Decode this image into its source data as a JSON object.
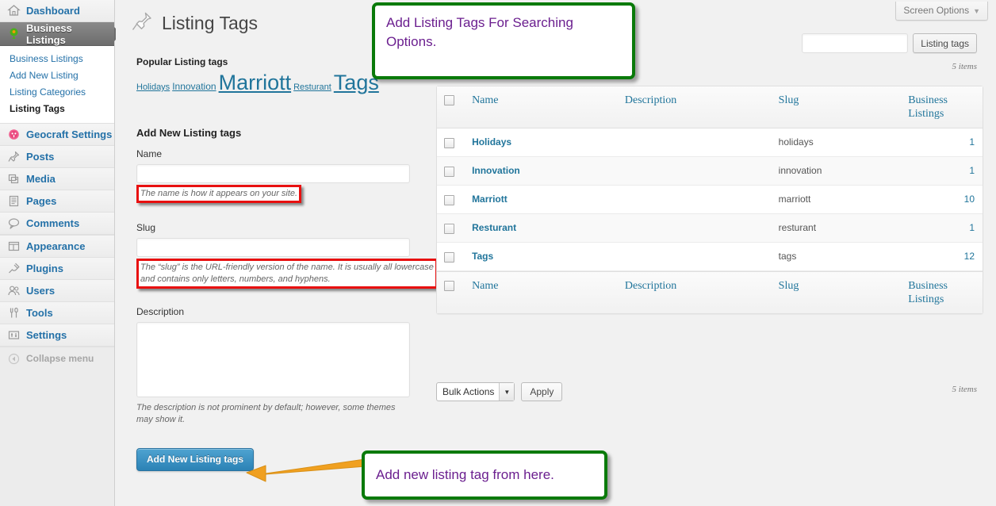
{
  "sidebar": {
    "items": [
      {
        "label": "Dashboard",
        "icon": "dashboard-icon",
        "active": false
      },
      {
        "label": "Business Listings",
        "icon": "business-listings-icon",
        "active": true
      },
      {
        "label": "Geocraft Settings",
        "icon": "geocraft-icon",
        "active": false
      },
      {
        "label": "Posts",
        "icon": "pin-icon",
        "active": false
      },
      {
        "label": "Media",
        "icon": "media-icon",
        "active": false
      },
      {
        "label": "Pages",
        "icon": "pages-icon",
        "active": false
      },
      {
        "label": "Comments",
        "icon": "comments-icon",
        "active": false
      },
      {
        "label": "Appearance",
        "icon": "appearance-icon",
        "active": false
      },
      {
        "label": "Plugins",
        "icon": "plugins-icon",
        "active": false
      },
      {
        "label": "Users",
        "icon": "users-icon",
        "active": false
      },
      {
        "label": "Tools",
        "icon": "tools-icon",
        "active": false
      },
      {
        "label": "Settings",
        "icon": "settings-icon",
        "active": false
      }
    ],
    "submenu": [
      {
        "label": "Business Listings",
        "current": false
      },
      {
        "label": "Add New Listing",
        "current": false
      },
      {
        "label": "Listing Categories",
        "current": false
      },
      {
        "label": "Listing Tags",
        "current": true
      }
    ],
    "collapse_label": "Collapse menu"
  },
  "header": {
    "screen_options_label": "Screen Options",
    "screen_options_caret": "▼",
    "page_title": "Listing Tags"
  },
  "popular": {
    "heading": "Popular Listing tags",
    "tags": [
      {
        "label": "Holidays",
        "size": 11
      },
      {
        "label": "Innovation",
        "size": 12
      },
      {
        "label": "Marriott",
        "size": 27
      },
      {
        "label": "Resturant",
        "size": 11
      },
      {
        "label": "Tags",
        "size": 27
      }
    ]
  },
  "form": {
    "heading": "Add New Listing tags",
    "name_label": "Name",
    "name_value": "",
    "name_help": "The name is how it appears on your site.",
    "slug_label": "Slug",
    "slug_value": "",
    "slug_help": "The “slug” is the URL-friendly version of the name. It is usually all lowercase and contains only letters, numbers, and hyphens.",
    "description_label": "Description",
    "description_value": "",
    "description_help": "The description is not prominent by default; however, some themes may show it.",
    "submit_label": "Add New Listing tags"
  },
  "search": {
    "value": "",
    "button_label": "Listing tags"
  },
  "table": {
    "items_top": "5 items",
    "items_bottom": "5 items",
    "columns": [
      "Name",
      "Description",
      "Slug",
      "Business Listings"
    ],
    "rows": [
      {
        "name": "Holidays",
        "description": "",
        "slug": "holidays",
        "count": "1"
      },
      {
        "name": "Innovation",
        "description": "",
        "slug": "innovation",
        "count": "1"
      },
      {
        "name": "Marriott",
        "description": "",
        "slug": "marriott",
        "count": "10"
      },
      {
        "name": "Resturant",
        "description": "",
        "slug": "resturant",
        "count": "1"
      },
      {
        "name": "Tags",
        "description": "",
        "slug": "tags",
        "count": "12"
      }
    ]
  },
  "bulk": {
    "select_value": "Bulk Actions",
    "select_caret": "▼",
    "apply_label": "Apply"
  },
  "annotations": {
    "top_callout": "Add Listing Tags For Searching Options.",
    "bottom_callout": "Add new listing tag from here."
  },
  "colors": {
    "callout_border": "#0a7a0a",
    "callout_text": "#6b1f8f",
    "annotation_red": "#e81010",
    "arrow_orange": "#f0a020",
    "link_blue": "#21759b",
    "submit_blue": "#2b82b5"
  }
}
